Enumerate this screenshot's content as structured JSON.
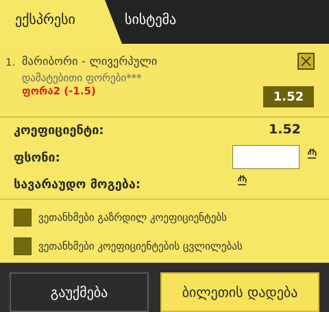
{
  "tabs": {
    "express_label": "ექსპრესი",
    "system_label": "სისტემა"
  },
  "bet": {
    "number": "1.",
    "match": "მარიბორი - ლივერპული",
    "market": "დამატებითი ფორები***",
    "pick": "ფორა2 (-1.5)",
    "odds": "1.52"
  },
  "summary": {
    "coef_label": "კოეფიციენტი:",
    "coef_value": "1.52",
    "stake_label": "ფსონი:",
    "stake_value": "",
    "win_label": "სავარაუდო მოგება:",
    "currency_icon": "lari-icon"
  },
  "options": {
    "accept_increased": "ვეთანხმები გაზრდილ კოეფიციენტებს",
    "accept_changes": "ვეთანხმები კოეფიციენტების ცვლილებას"
  },
  "buttons": {
    "cancel": "გაუქმება",
    "place": "ბილეთის დადება"
  },
  "colors": {
    "accent": "#f6e766",
    "dark": "#2e2e2e",
    "pick_red": "#d22020",
    "odds_box": "#6c620a"
  }
}
